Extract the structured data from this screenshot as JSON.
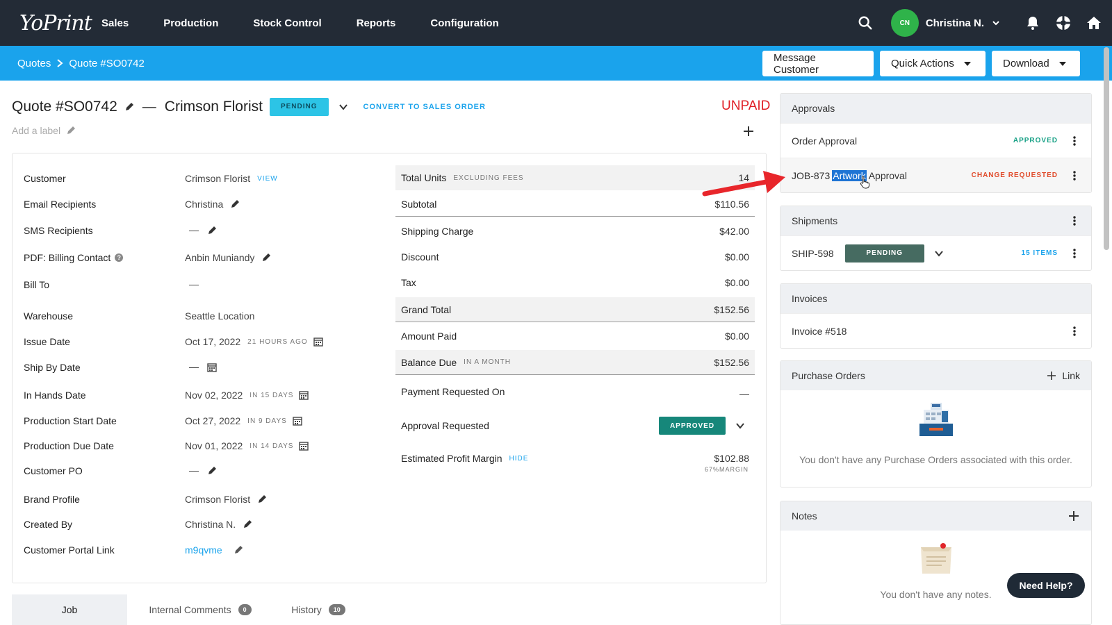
{
  "nav": {
    "logo": "YoPrint",
    "items": [
      "Sales",
      "Production",
      "Stock Control",
      "Reports",
      "Configuration"
    ],
    "user_initials": "CN",
    "user_name": "Christina N."
  },
  "subbar": {
    "breadcrumb_root": "Quotes",
    "breadcrumb_current": "Quote #SO0742",
    "buttons": {
      "message": "Message Customer",
      "quick_actions": "Quick Actions",
      "download": "Download"
    }
  },
  "header": {
    "quote_title": "Quote #SO0742",
    "customer": "Crimson Florist",
    "status": "PENDING",
    "convert": "CONVERT TO SALES ORDER",
    "payment_status": "UNPAID",
    "add_label": "Add a label"
  },
  "details": {
    "customer": {
      "label": "Customer",
      "value": "Crimson Florist",
      "link": "VIEW"
    },
    "email": {
      "label": "Email Recipients",
      "value": "Christina"
    },
    "sms": {
      "label": "SMS Recipients"
    },
    "billing": {
      "label": "PDF: Billing Contact",
      "value": "Anbin Muniandy"
    },
    "bill_to": {
      "label": "Bill To"
    },
    "warehouse": {
      "label": "Warehouse",
      "value": "Seattle Location"
    },
    "issue_date": {
      "label": "Issue Date",
      "value": "Oct 17, 2022",
      "note": "21 HOURS AGO"
    },
    "ship_by": {
      "label": "Ship By Date"
    },
    "in_hands": {
      "label": "In Hands Date",
      "value": "Nov 02, 2022",
      "note": "IN 15 DAYS"
    },
    "prod_start": {
      "label": "Production Start Date",
      "value": "Oct 27, 2022",
      "note": "IN 9 DAYS"
    },
    "prod_due": {
      "label": "Production Due Date",
      "value": "Nov 01, 2022",
      "note": "IN 14 DAYS"
    },
    "customer_po": {
      "label": "Customer PO"
    },
    "brand": {
      "label": "Brand Profile",
      "value": "Crimson Florist"
    },
    "created_by": {
      "label": "Created By",
      "value": "Christina N."
    },
    "portal": {
      "label": "Customer Portal Link",
      "value": "m9qvme"
    }
  },
  "totals": {
    "units": {
      "label": "Total Units",
      "note": "EXCLUDING FEES",
      "value": "14"
    },
    "subtotal": {
      "label": "Subtotal",
      "value": "$110.56"
    },
    "shipping": {
      "label": "Shipping Charge",
      "value": "$42.00"
    },
    "discount": {
      "label": "Discount",
      "value": "$0.00"
    },
    "tax": {
      "label": "Tax",
      "value": "$0.00"
    },
    "grand": {
      "label": "Grand Total",
      "value": "$152.56"
    },
    "paid": {
      "label": "Amount Paid",
      "value": "$0.00"
    },
    "balance": {
      "label": "Balance Due",
      "note": "IN A MONTH",
      "value": "$152.56"
    },
    "payment_req": {
      "label": "Payment Requested On"
    },
    "approval": {
      "label": "Approval Requested",
      "status": "APPROVED"
    },
    "profit": {
      "label": "Estimated Profit Margin",
      "link": "HIDE",
      "value": "$102.88",
      "sub": "67%MARGIN"
    }
  },
  "tabs": {
    "job": "Job",
    "comments": {
      "label": "Internal Comments",
      "count": "0"
    },
    "history": {
      "label": "History",
      "count": "10"
    }
  },
  "approvals": {
    "title": "Approvals",
    "order": {
      "label": "Order Approval",
      "status": "APPROVED"
    },
    "artwork": {
      "prefix": "JOB-873",
      "highlight": "Artwork",
      "suffix": "Approval",
      "status": "CHANGE REQUESTED"
    }
  },
  "shipments": {
    "title": "Shipments",
    "item": {
      "id": "SHIP-598",
      "status": "PENDING",
      "count": "15 ITEMS"
    }
  },
  "invoices": {
    "title": "Invoices",
    "item": "Invoice #518"
  },
  "purchase_orders": {
    "title": "Purchase Orders",
    "link": "Link",
    "empty": "You don't have any Purchase Orders associated with this order."
  },
  "notes": {
    "title": "Notes",
    "empty": "You don't have any notes."
  },
  "help": "Need Help?",
  "colors": {
    "nav_bg": "#232b36",
    "accent": "#1aa3ec",
    "approved": "#16877a",
    "unpaid": "#e01f26",
    "arrow": "#e8262b"
  }
}
